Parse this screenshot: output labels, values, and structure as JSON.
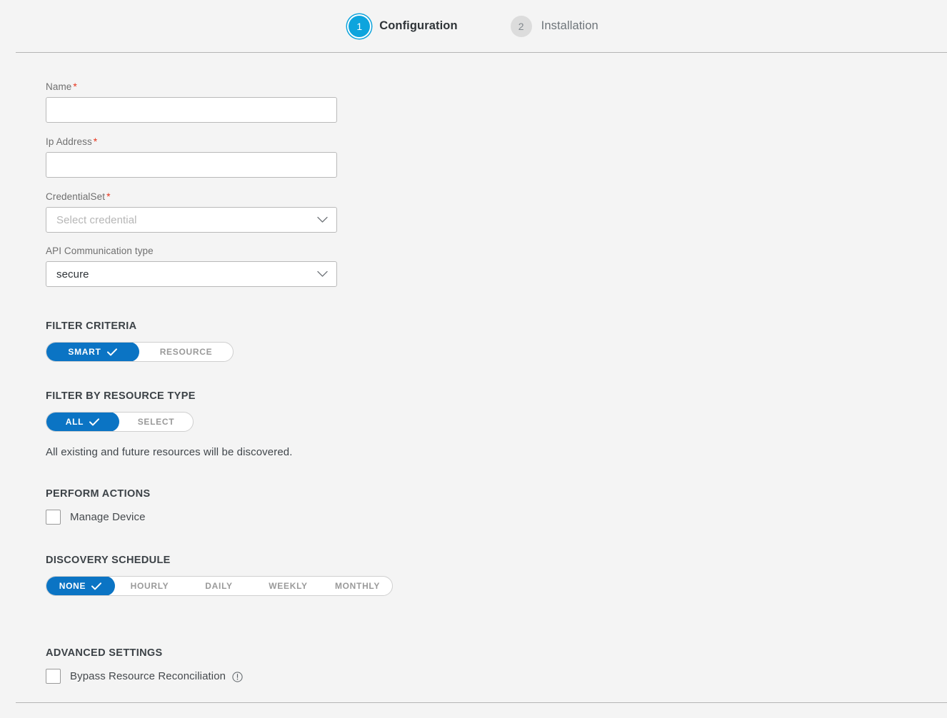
{
  "wizard": {
    "steps": [
      {
        "number": "1",
        "label": "Configuration",
        "state": "active"
      },
      {
        "number": "2",
        "label": "Installation",
        "state": "inactive"
      }
    ]
  },
  "form": {
    "name": {
      "label": "Name",
      "required_marker": "*",
      "value": "",
      "placeholder": ""
    },
    "ip_address": {
      "label": "Ip Address",
      "required_marker": "*",
      "value": "",
      "placeholder": ""
    },
    "credential_set": {
      "label": "CredentialSet",
      "required_marker": "*",
      "value": "Select credential",
      "chevron_icon": "chevron-down-icon"
    },
    "api_communication_type": {
      "label": "API Communication type",
      "value": "secure",
      "chevron_icon": "chevron-down-icon"
    }
  },
  "filter_criteria": {
    "title": "FILTER CRITERIA",
    "options": [
      {
        "label": "SMART",
        "selected": true
      },
      {
        "label": "RESOURCE",
        "selected": false
      }
    ]
  },
  "filter_by_resource_type": {
    "title": "FILTER BY RESOURCE TYPE",
    "options": [
      {
        "label": "ALL",
        "selected": true
      },
      {
        "label": "SELECT",
        "selected": false
      }
    ],
    "helper_text": "All existing and future resources will be discovered."
  },
  "perform_actions": {
    "title": "PERFORM ACTIONS",
    "items": [
      {
        "label": "Manage Device",
        "checked": false
      }
    ]
  },
  "discovery_schedule": {
    "title": "DISCOVERY SCHEDULE",
    "options": [
      {
        "label": "NONE",
        "selected": true
      },
      {
        "label": "HOURLY",
        "selected": false
      },
      {
        "label": "DAILY",
        "selected": false
      },
      {
        "label": "WEEKLY",
        "selected": false
      },
      {
        "label": "MONTHLY",
        "selected": false
      }
    ]
  },
  "advanced_settings": {
    "title": "ADVANCED SETTINGS",
    "items": [
      {
        "label": "Bypass Resource Reconciliation",
        "checked": false,
        "info_icon": "info-exclamation-icon"
      }
    ]
  },
  "colors": {
    "background": "#f4f4f4",
    "accent_blue": "#0b74c4",
    "step_active_blue": "#0ea4dd",
    "required_red": "#e8341c",
    "divider": "#b4b4b4"
  }
}
